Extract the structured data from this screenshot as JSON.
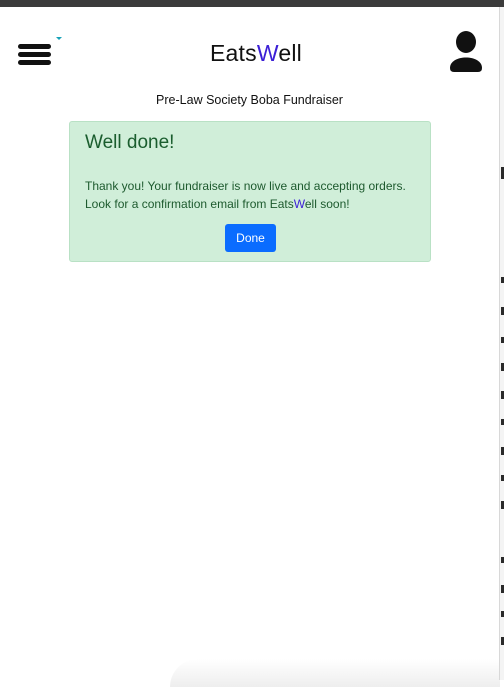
{
  "header": {
    "brand_prefix": "Eats",
    "brand_accent": "W",
    "brand_suffix": "ell",
    "menu_icon": "hamburger-menu-icon",
    "user_icon": "user-silhouette-icon"
  },
  "page": {
    "subtitle": "Pre-Law Society Boba Fundraiser"
  },
  "alert": {
    "heading": "Well done!",
    "line1": "Thank you! Your fundraiser is now live and accepting orders.",
    "line2_prefix": "Look for a confirmation email from Eats",
    "line2_accent": "W",
    "line2_suffix": "ell soon!",
    "done_label": "Done"
  },
  "colors": {
    "accent": "#3b1fd6",
    "alert_bg": "#d0eed9",
    "alert_text": "#1d5a2e",
    "primary_button": "#0a6cff"
  }
}
